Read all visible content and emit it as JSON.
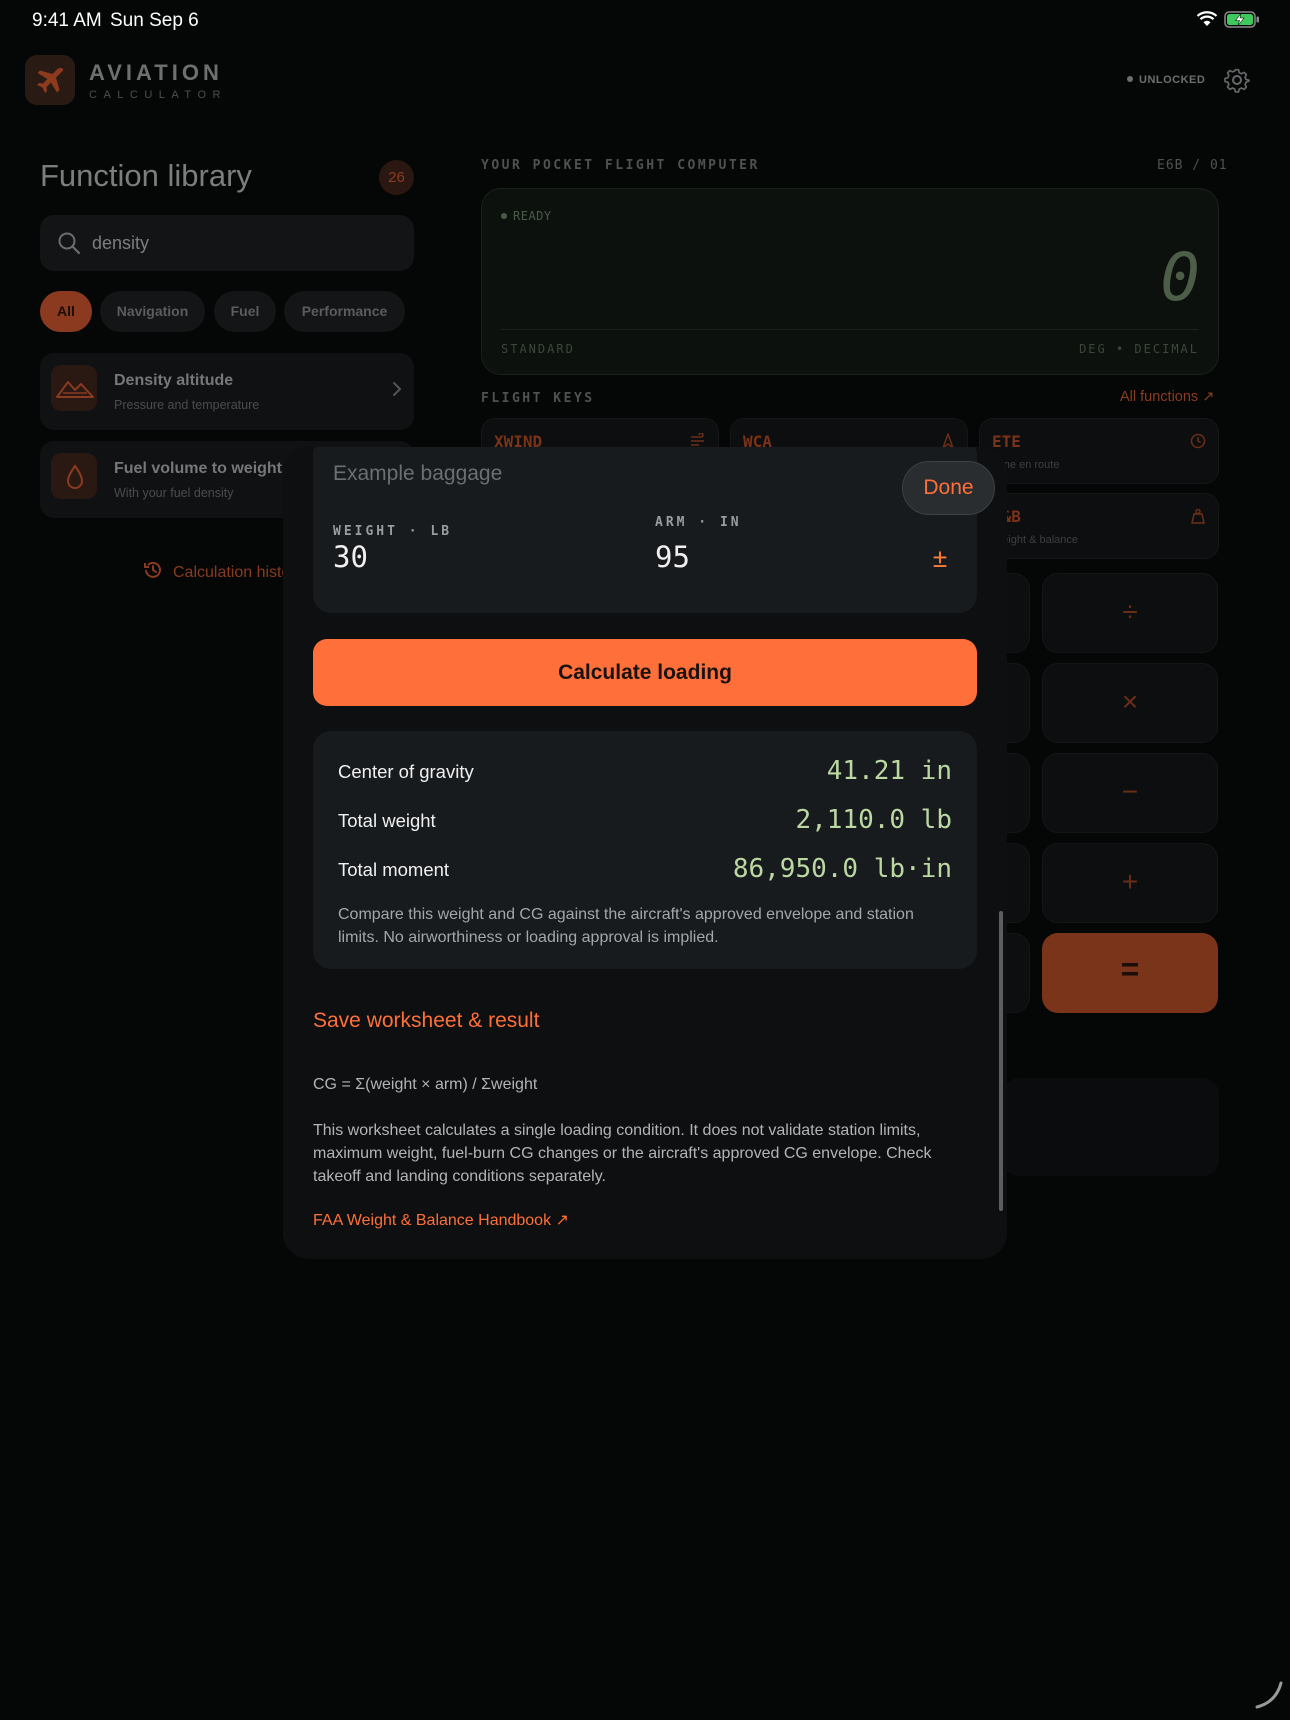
{
  "status_bar": {
    "time": "9:41 AM",
    "date": "Sun Sep 6"
  },
  "app": {
    "name": "AVIATION",
    "subtitle": "CALCULATOR",
    "unlock_status": "UNLOCKED"
  },
  "library": {
    "title": "Function library",
    "count": "26",
    "search": {
      "value": "density"
    },
    "filters": [
      {
        "label": "All",
        "active": true
      },
      {
        "label": "Navigation"
      },
      {
        "label": "Fuel"
      },
      {
        "label": "Performance"
      }
    ],
    "results": [
      {
        "title": "Density altitude",
        "subtitle": "Pressure and temperature",
        "icon": "mountain-icon"
      },
      {
        "title": "Fuel volume to weight",
        "subtitle": "With your fuel density",
        "icon": "fuel-drop-icon"
      }
    ],
    "history_label": "Calculation history"
  },
  "computer": {
    "section_label": "YOUR POCKET FLIGHT COMPUTER",
    "code": "E6B / 01",
    "display": {
      "status": "READY",
      "value": "0",
      "mode": "STANDARD",
      "units": "DEG • DECIMAL"
    },
    "flight_keys_label": "FLIGHT KEYS",
    "all_functions_label": "All functions ↗",
    "flight_keys": [
      {
        "name": "XWIND",
        "subtitle": "",
        "icon": "wind-icon"
      },
      {
        "name": "WCA",
        "subtitle": "",
        "icon": "compass-icon"
      },
      {
        "name": "ETE",
        "subtitle": "Time en route",
        "icon": "clock-icon"
      },
      {
        "name": "W&B",
        "subtitle": "Weight & balance",
        "icon": "weight-icon"
      }
    ],
    "operators": [
      "÷",
      "×",
      "−",
      "+",
      "="
    ]
  },
  "sheet": {
    "station_name": "Example baggage",
    "done_label": "Done",
    "weight_label": "WEIGHT · LB",
    "weight_value": "30",
    "arm_label": "ARM · IN",
    "arm_value": "95",
    "sign_toggle": "±",
    "calculate_label": "Calculate loading",
    "results": [
      {
        "label": "Center of gravity",
        "value": "41.21 in"
      },
      {
        "label": "Total weight",
        "value": "2,110.0 lb"
      },
      {
        "label": "Total moment",
        "value": "86,950.0 lb·in"
      }
    ],
    "result_note": "Compare this weight and CG against the aircraft's approved envelope and station limits. No airworthiness or loading approval is implied.",
    "save_label": "Save worksheet & result",
    "formula": "CG = Σ(weight × arm) / Σweight",
    "worksheet_note": "This worksheet calculates a single loading condition. It does not validate station limits, maximum weight, fuel-burn CG changes or the aircraft's approved CG envelope. Check takeoff and landing conditions separately.",
    "reference_link": "FAA Weight & Balance Handbook ↗"
  },
  "colors": {
    "accent": "#ff6f3a",
    "result_value": "#bcd8a2",
    "background": "#050606",
    "sheet": "#0d0f11"
  }
}
